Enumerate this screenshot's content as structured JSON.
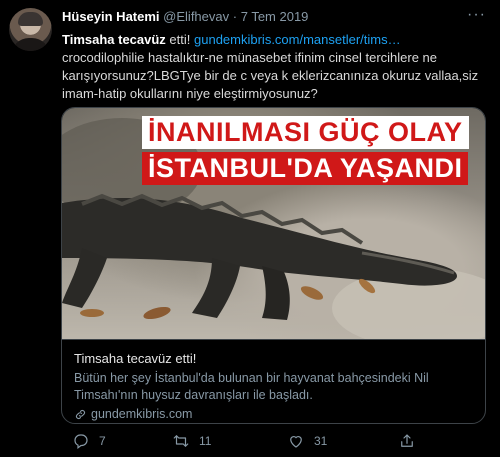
{
  "tweet": {
    "author_name": "Hüseyin Hatemi",
    "handle": "@Elifhevav",
    "separator": "·",
    "date": "7 Tem 2019",
    "more_label": "···",
    "text_strong": "Timsaha tecavüz",
    "text_after_strong": " etti! ",
    "text_link": "gundemkibris.com/mansetler/tims…",
    "text_rest": "crocodilophilie hastalıktır-ne münasebet ifinim cinsel tercihlere ne karışıyorsunuz?LBGTye bir de c veya k eklerizcanınıza okuruz vallaa,siz imam-hatip okullarını niye eleştirmiyosunuz?"
  },
  "card": {
    "headline_line1": "İNANILMASI GÜÇ OLAY",
    "headline_line2": "İSTANBUL'DA YAŞANDI",
    "title": "Timsaha tecavüz etti!",
    "description": "Bütün her şey İstanbul'da bulunan bir hayvanat bahçesindeki Nil Timsahı'nın huysuz davranışları ile başladı.",
    "domain": "gundemkibris.com"
  },
  "actions": {
    "reply_count": "7",
    "retweet_count": "11",
    "like_count": "31"
  },
  "colors": {
    "background": "#000000",
    "link": "#1da1f2",
    "muted": "#8899a6",
    "headline_red": "#d01818"
  },
  "icons": [
    "reply-icon",
    "retweet-icon",
    "like-icon",
    "share-icon",
    "link-icon",
    "more-icon"
  ]
}
